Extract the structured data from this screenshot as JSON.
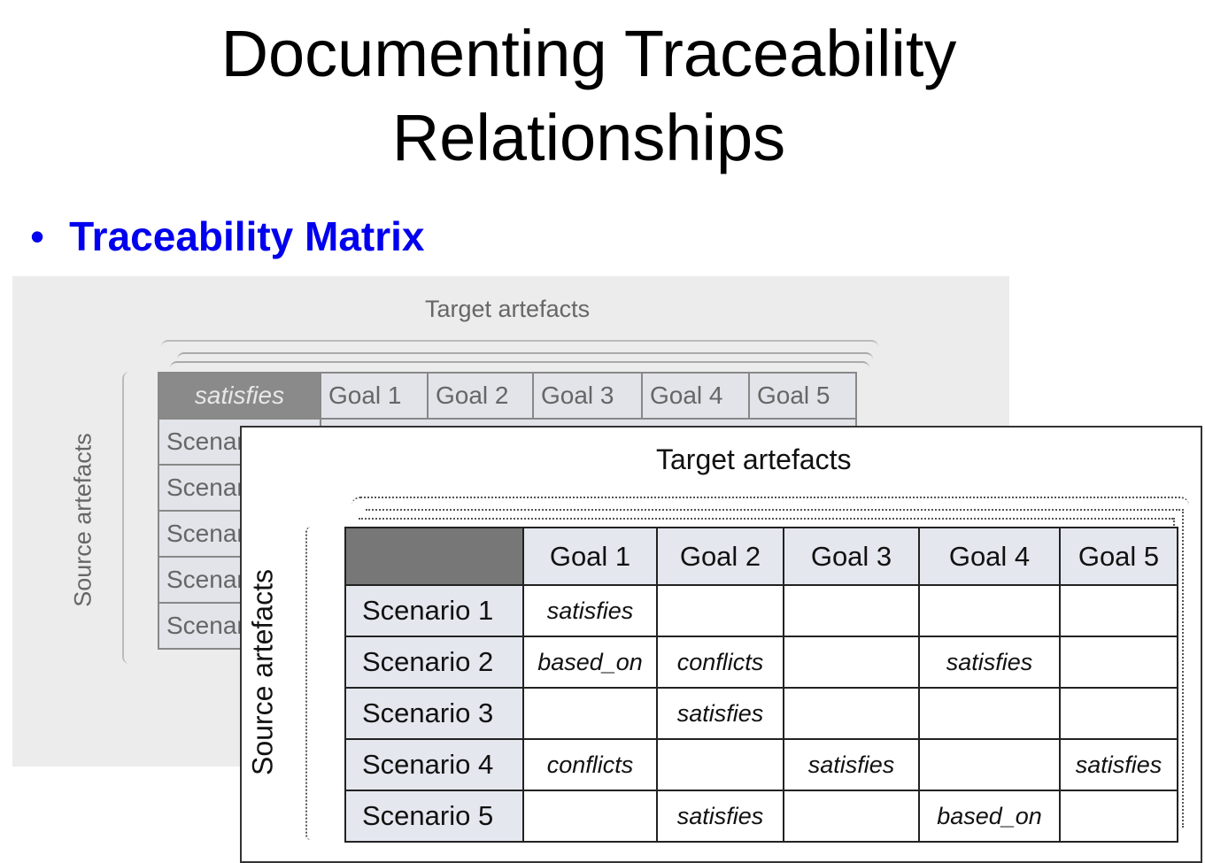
{
  "title": {
    "line1": "Documenting Traceability",
    "line2": "Relationships"
  },
  "bullet": {
    "marker": "•",
    "text": "Traceability Matrix"
  },
  "back_figure": {
    "target_label": "Target artefacts",
    "source_label": "Source artefacts",
    "corner": "satisfies",
    "columns": [
      "Goal 1",
      "Goal 2",
      "Goal 3",
      "Goal 4",
      "Goal 5"
    ],
    "rows": [
      "Scenario 1",
      "Scenario 2",
      "Scenario 3",
      "Scenario 4",
      "Scenario 5"
    ]
  },
  "front_figure": {
    "target_label": "Target artefacts",
    "source_label": "Source artefacts",
    "columns": [
      "Goal 1",
      "Goal 2",
      "Goal 3",
      "Goal 4",
      "Goal 5"
    ],
    "rows": [
      {
        "label": "Scenario 1",
        "cells": [
          "satisfies",
          "",
          "",
          "",
          ""
        ]
      },
      {
        "label": "Scenario 2",
        "cells": [
          "based_on",
          "conflicts",
          "",
          "satisfies",
          ""
        ]
      },
      {
        "label": "Scenario 3",
        "cells": [
          "",
          "satisfies",
          "",
          "",
          ""
        ]
      },
      {
        "label": "Scenario 4",
        "cells": [
          "conflicts",
          "",
          "satisfies",
          "",
          "satisfies"
        ]
      },
      {
        "label": "Scenario 5",
        "cells": [
          "",
          "satisfies",
          "",
          "based_on",
          ""
        ]
      }
    ]
  }
}
